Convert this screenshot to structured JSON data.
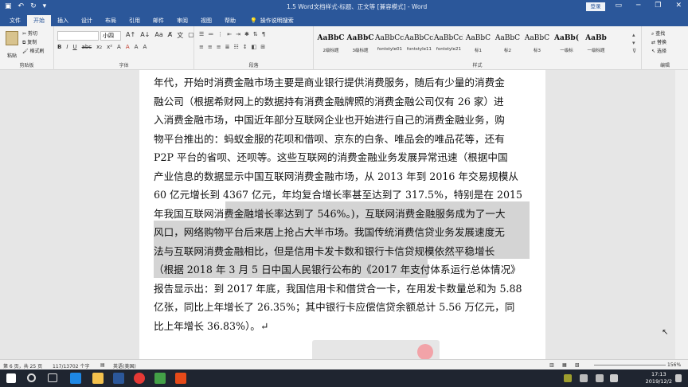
{
  "titlebar": {
    "title": "1.5 Word文档样式-标题、正文等 [兼容模式] - Word",
    "login": "登录",
    "save_icon": "save-icon",
    "undo_icon": "undo-icon",
    "redo_icon": "redo-icon"
  },
  "tabs": [
    "文件",
    "开始",
    "插入",
    "设计",
    "布局",
    "引用",
    "邮件",
    "审阅",
    "视图",
    "帮助"
  ],
  "active_tab": "开始",
  "tellme": "操作说明搜索",
  "clipboard": {
    "paste": "粘贴",
    "cut": "剪切",
    "copy": "复制",
    "painter": "格式刷",
    "label": "剪贴板"
  },
  "font": {
    "size": "小四",
    "label": "字体",
    "buttons": [
      "B",
      "I",
      "U",
      "abc",
      "x₂",
      "x²",
      "A",
      "A",
      "A",
      "A"
    ]
  },
  "paragraph": {
    "label": "段落"
  },
  "styles": {
    "label": "样式",
    "items": [
      {
        "preview": "AaBbC",
        "name": "2级标题"
      },
      {
        "preview": "AaBbC",
        "name": "3级标题"
      },
      {
        "preview": "AaBbCcI",
        "name": "fontstyle01"
      },
      {
        "preview": "AaBbCcI",
        "name": "fontstyle11"
      },
      {
        "preview": "AaBbCcI",
        "name": "fontstyle21"
      },
      {
        "preview": "AaBbC",
        "name": "标1"
      },
      {
        "preview": "AaBbC",
        "name": "标2"
      },
      {
        "preview": "AaBbC",
        "name": "标3"
      },
      {
        "preview": "AaBb(",
        "name": "一级标"
      },
      {
        "preview": "AaBb",
        "name": "一级标题"
      }
    ]
  },
  "editing": {
    "find": "查找",
    "replace": "替换",
    "select": "选择",
    "label": "编辑"
  },
  "document": {
    "lines": [
      "年代，开始时消费金融市场主要是商业银行提供消费服务，随后有少量的消费金",
      "融公司（根据希财网上的数据持有消费金融牌照的消费金融公司仅有 26 家）进",
      "入消费金融市场，中国近年部分互联网企业也开始进行自己的消费金融业务，购",
      "物平台推出的：蚂蚁金服的花呗和借呗、京东的白条、唯品会的唯品花等，还有",
      "P2P 平台的省呗、还呗等。这些互联网的消费金融业务发展异常迅速（根据中国",
      "产业信息的数据显示中国互联网消费金融市场，从 2013 年到 2016 年交易规模从",
      "60 亿元增长到 4367 亿元，年均复合增长率甚至达到了 317.5%，特别是在 2015",
      "年我国互联网消费金融增长率达到了 546%。)，互联网消费金融服务成为了一大",
      "风口，网络购物平台后来居上抢占大半市场。我国传统消费信贷业务发展速度无",
      "法与互联网消费金融相比，但是信用卡发卡数和银行卡信贷规模依然平稳增长",
      "（根据 2018 年 3 月 5 日中国人民银行公布的《2017 年支付体系运行总体情况》",
      "报告显示出：到 2017 年底，我国信用卡和借贷合一卡，在用发卡数量总和为 5.88",
      "亿张，同比上年增长了 26.35%；其中银行卡应偿信贷余额总计 5.56 万亿元，同",
      "比上年增长 36.83%）。↵"
    ]
  },
  "status": {
    "page": "第 6 页，共 25 页",
    "words": "117/13702 个字",
    "lang": "英语(美国)",
    "zoom": "156%"
  },
  "clock": {
    "time": "17:13",
    "date": "2019/12/2"
  }
}
